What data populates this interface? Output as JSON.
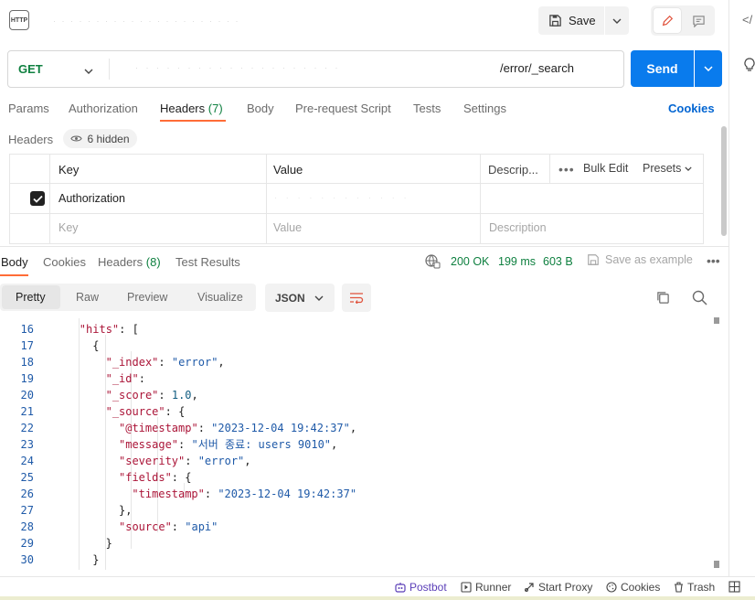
{
  "app": {
    "badge": "HTTP",
    "title_obscured": "· · · · · · · · · · · · · · · · · · · · · ·"
  },
  "toolbar": {
    "save_label": "Save"
  },
  "request": {
    "method": "GET",
    "url_obscured": "· · · · · · · · · · · · · · · · · · · ·",
    "url_visible": "/error/_search",
    "send_label": "Send"
  },
  "request_tabs": {
    "params": "Params",
    "authorization": "Authorization",
    "headers": "Headers",
    "headers_count": "(7)",
    "body": "Body",
    "pre_request": "Pre-request Script",
    "tests": "Tests",
    "settings": "Settings",
    "cookies": "Cookies"
  },
  "headers_section": {
    "label": "Headers",
    "hidden": "6 hidden",
    "col_key": "Key",
    "col_value": "Value",
    "col_description": "Descrip...",
    "bulk_edit": "Bulk Edit",
    "presets": "Presets",
    "row_key": "Authorization",
    "row_value_obscured": "· · · · · · · · · · · ·",
    "placeholder_key": "Key",
    "placeholder_value": "Value",
    "placeholder_description": "Description"
  },
  "response_tabs": {
    "body": "Body",
    "cookies": "Cookies",
    "headers": "Headers",
    "headers_count": "(8)",
    "test_results": "Test Results",
    "status": "200 OK",
    "time": "199 ms",
    "size": "603 B",
    "save_example": "Save as example"
  },
  "view": {
    "pretty": "Pretty",
    "raw": "Raw",
    "preview": "Preview",
    "visualize": "Visualize",
    "format": "JSON"
  },
  "code": {
    "lines": [
      {
        "n": "16",
        "indent": 4,
        "parts": [
          [
            "k",
            "\"hits\""
          ],
          [
            "p",
            ": ["
          ]
        ]
      },
      {
        "n": "17",
        "indent": 6,
        "parts": [
          [
            "p",
            "{"
          ]
        ]
      },
      {
        "n": "18",
        "indent": 8,
        "parts": [
          [
            "k",
            "\"_index\""
          ],
          [
            "p",
            ": "
          ],
          [
            "s",
            "\"error\""
          ],
          [
            "p",
            ","
          ]
        ]
      },
      {
        "n": "19",
        "indent": 8,
        "parts": [
          [
            "k",
            "\"_id\""
          ],
          [
            "p",
            ":"
          ]
        ]
      },
      {
        "n": "20",
        "indent": 8,
        "parts": [
          [
            "k",
            "\"_score\""
          ],
          [
            "p",
            ": "
          ],
          [
            "n",
            "1.0"
          ],
          [
            "p",
            ","
          ]
        ]
      },
      {
        "n": "21",
        "indent": 8,
        "parts": [
          [
            "k",
            "\"_source\""
          ],
          [
            "p",
            ": {"
          ]
        ]
      },
      {
        "n": "22",
        "indent": 10,
        "parts": [
          [
            "k",
            "\"@timestamp\""
          ],
          [
            "p",
            ": "
          ],
          [
            "s",
            "\"2023-12-04 19:42:37\""
          ],
          [
            "p",
            ","
          ]
        ]
      },
      {
        "n": "23",
        "indent": 10,
        "parts": [
          [
            "k",
            "\"message\""
          ],
          [
            "p",
            ": "
          ],
          [
            "s",
            "\"서버 종료: users 9010\""
          ],
          [
            "p",
            ","
          ]
        ]
      },
      {
        "n": "24",
        "indent": 10,
        "parts": [
          [
            "k",
            "\"severity\""
          ],
          [
            "p",
            ": "
          ],
          [
            "s",
            "\"error\""
          ],
          [
            "p",
            ","
          ]
        ]
      },
      {
        "n": "25",
        "indent": 10,
        "parts": [
          [
            "k",
            "\"fields\""
          ],
          [
            "p",
            ": {"
          ]
        ]
      },
      {
        "n": "26",
        "indent": 12,
        "parts": [
          [
            "k",
            "\"timestamp\""
          ],
          [
            "p",
            ": "
          ],
          [
            "s",
            "\"2023-12-04 19:42:37\""
          ]
        ]
      },
      {
        "n": "27",
        "indent": 10,
        "parts": [
          [
            "p",
            "},"
          ]
        ]
      },
      {
        "n": "28",
        "indent": 10,
        "parts": [
          [
            "k",
            "\"source\""
          ],
          [
            "p",
            ": "
          ],
          [
            "s",
            "\"api\""
          ]
        ]
      },
      {
        "n": "29",
        "indent": 8,
        "parts": [
          [
            "p",
            "}"
          ]
        ]
      },
      {
        "n": "30",
        "indent": 6,
        "parts": [
          [
            "p",
            "}"
          ]
        ]
      }
    ]
  },
  "footer": {
    "postbot": "Postbot",
    "runner": "Runner",
    "start_proxy": "Start Proxy",
    "cookies": "Cookies",
    "trash": "Trash"
  },
  "colors": {
    "accent": "#ff6c37",
    "send": "#097bed",
    "method": "#0f8040",
    "status": "#0f8040",
    "key": "#ab1538",
    "string": "#1f5aa8"
  },
  "icons": [
    "http-icon",
    "save-icon",
    "chevron-down-icon",
    "pencil-icon",
    "comment-icon",
    "code-icon",
    "lightbulb-icon",
    "eye-icon",
    "more-icon",
    "globe-icon",
    "save-example-icon",
    "wrap-icon",
    "copy-icon",
    "search-icon",
    "postbot-icon",
    "runner-icon",
    "proxy-icon",
    "cookie-icon",
    "trash-icon",
    "layout-icon"
  ]
}
